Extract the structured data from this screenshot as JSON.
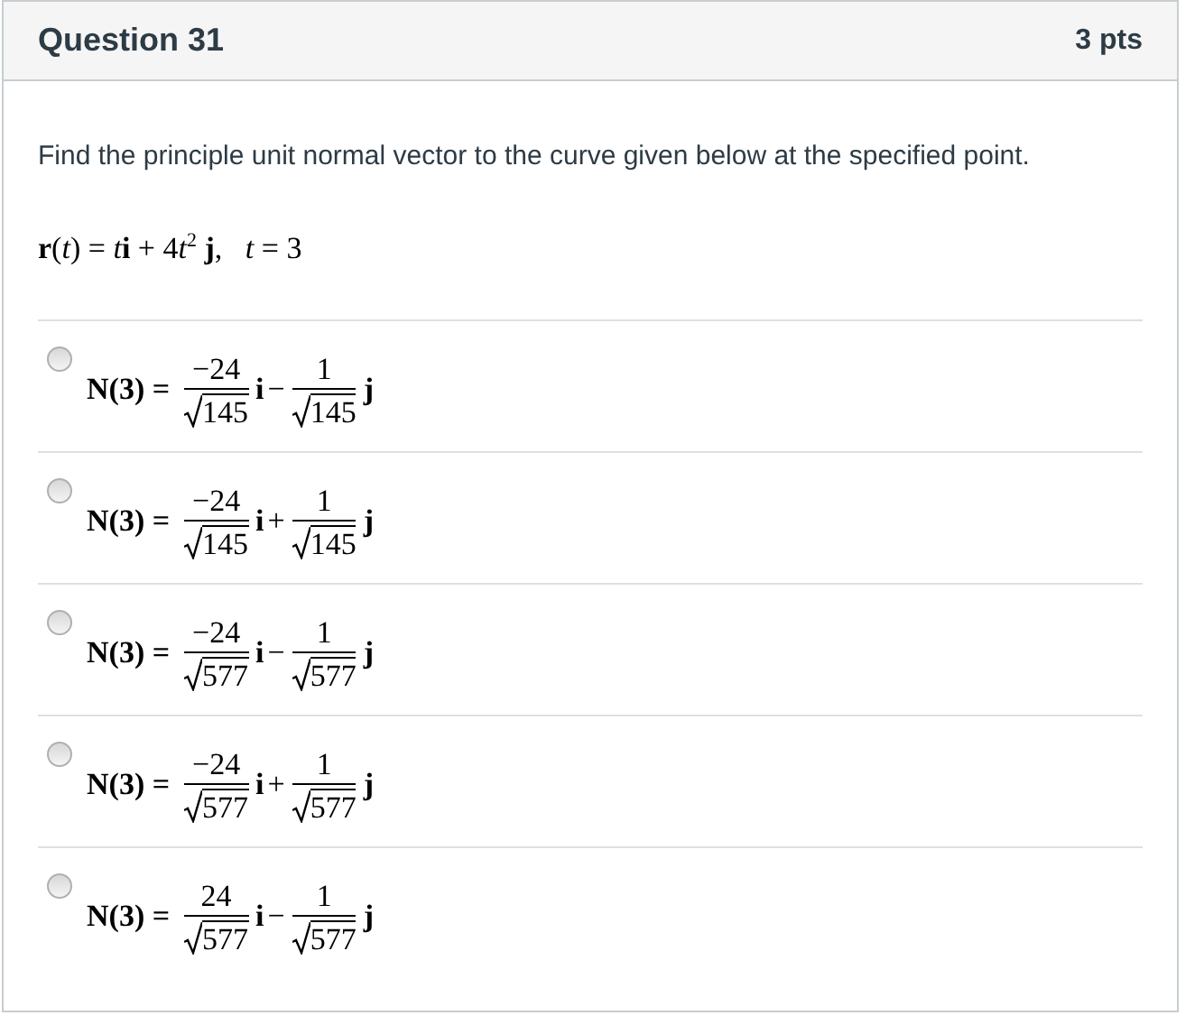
{
  "header": {
    "title": "Question 31",
    "points": "3 pts"
  },
  "question": {
    "text": "Find the principle unit normal vector to the curve given below at the specified point.",
    "formula": [
      {
        "kind": "bold",
        "text": "r"
      },
      {
        "kind": "plain",
        "text": "("
      },
      {
        "kind": "italic",
        "text": "t"
      },
      {
        "kind": "plain",
        "text": ") = "
      },
      {
        "kind": "italic",
        "text": "t"
      },
      {
        "kind": "bold",
        "text": "i"
      },
      {
        "kind": "plain",
        "text": " + 4"
      },
      {
        "kind": "italic",
        "text": "t"
      },
      {
        "kind": "sup",
        "text": "2"
      },
      {
        "kind": "bold",
        "text": " j"
      },
      {
        "kind": "plain",
        "text": ",   "
      },
      {
        "kind": "italic",
        "text": "t"
      },
      {
        "kind": "plain",
        "text": " = 3"
      }
    ]
  },
  "options": [
    {
      "selected": false,
      "lhs": "N(3) =",
      "num1": "−24",
      "den1": "145",
      "op": "−",
      "num2": "1",
      "den2": "145",
      "unit1": "i",
      "unit2": "j"
    },
    {
      "selected": false,
      "lhs": "N(3) =",
      "num1": "−24",
      "den1": "145",
      "op": "+",
      "num2": "1",
      "den2": "145",
      "unit1": "i",
      "unit2": "j"
    },
    {
      "selected": false,
      "lhs": "N(3) =",
      "num1": "−24",
      "den1": "577",
      "op": "−",
      "num2": "1",
      "den2": "577",
      "unit1": "i",
      "unit2": "j"
    },
    {
      "selected": false,
      "lhs": "N(3) =",
      "num1": "−24",
      "den1": "577",
      "op": "+",
      "num2": "1",
      "den2": "577",
      "unit1": "i",
      "unit2": "j"
    },
    {
      "selected": false,
      "lhs": "N(3) =",
      "num1": "24",
      "den1": "577",
      "op": "−",
      "num2": "1",
      "den2": "577",
      "unit1": "i",
      "unit2": "j"
    }
  ]
}
